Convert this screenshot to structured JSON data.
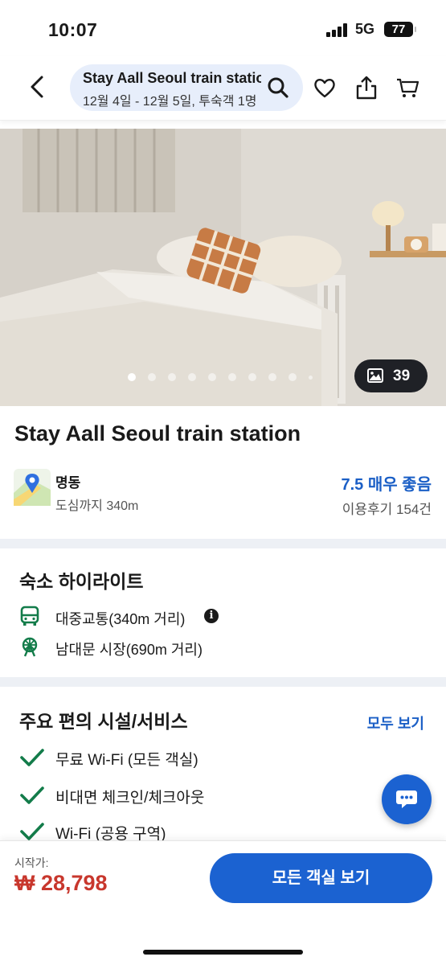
{
  "status_bar": {
    "time": "10:07",
    "network": "5G",
    "battery": "77"
  },
  "header": {
    "back_icon": "chevron-left-icon",
    "search": {
      "title": "Stay Aall Seoul train station",
      "subtitle": "12월 4일 - 12월 5일, 투숙객 1명"
    },
    "icons": [
      "search-icon",
      "heart-icon",
      "share-icon",
      "cart-icon"
    ]
  },
  "gallery": {
    "photo_count": "39",
    "dot_count": 10,
    "active_dot": 1
  },
  "property": {
    "name": "Stay Aall Seoul train station",
    "location_name": "명동",
    "location_distance": "도심까지 340m",
    "rating": "7.5 매우 좋음",
    "reviews": "이용후기 154건"
  },
  "highlights": {
    "title": "숙소 하이라이트",
    "items": [
      {
        "icon": "bus-icon",
        "text": "대중교통(340m 거리)"
      },
      {
        "icon": "ferris-wheel-icon",
        "text": "남대문 시장(690m 거리)"
      }
    ]
  },
  "amenities": {
    "title": "주요 편의 시설/서비스",
    "see_all": "모두 보기",
    "items": [
      "무료 Wi-Fi (모든 객실)",
      "비대면 체크인/체크아웃",
      "Wi-Fi (공용 구역)"
    ]
  },
  "bottom_bar": {
    "from_label": "시작가:",
    "price": "₩ 28,798",
    "cta": "모든 객실 보기"
  },
  "colors": {
    "accent_blue": "#1b62d1",
    "rating_blue": "#1b5fc6",
    "price_red": "#c8372d",
    "check_green": "#137c4a",
    "pill_bg": "#e7eefb"
  }
}
